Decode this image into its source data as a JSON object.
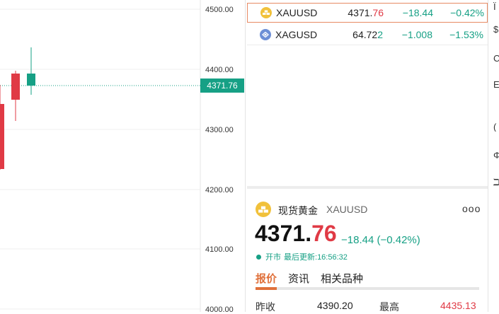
{
  "chart": {
    "y_axis_labels": [
      "4500.00",
      "4400.00",
      "4300.00",
      "4200.00",
      "4100.00",
      "4000.00"
    ],
    "current_price_tag": "4371.76",
    "colors": {
      "up": "#16a085",
      "down": "#e03a45",
      "grid": "#efefef"
    }
  },
  "watchlist": {
    "rows": [
      {
        "symbol": "XAUUSD",
        "price_main": "4371.",
        "price_last": "76",
        "change": "−18.44",
        "change_pct": "−0.42%",
        "icon": "gold-bars-icon"
      },
      {
        "symbol": "XAGUSD",
        "price_main": "64.72",
        "price_last": "2",
        "change": "−1.008",
        "change_pct": "−1.53%",
        "icon": "silver-icon"
      }
    ]
  },
  "detail": {
    "name": "现货黄金",
    "code": "XAUUSD",
    "price_main": "4371.",
    "price_last": "76",
    "change": "−18.44 (−0.42%)",
    "status": "开市",
    "updated_label": "最后更新:",
    "updated_time": "16:56:32",
    "more_label": "ooo",
    "tabs": [
      "报价",
      "资讯",
      "相关品种"
    ],
    "stats": {
      "prev_close_label": "昨收",
      "prev_close_value": "4390.20",
      "high_label": "最高",
      "high_value": "4435.13"
    }
  },
  "edge_icons": [
    "Ϊ",
    "$",
    "C",
    "E",
    "(",
    "Φ",
    "ℶ"
  ]
}
